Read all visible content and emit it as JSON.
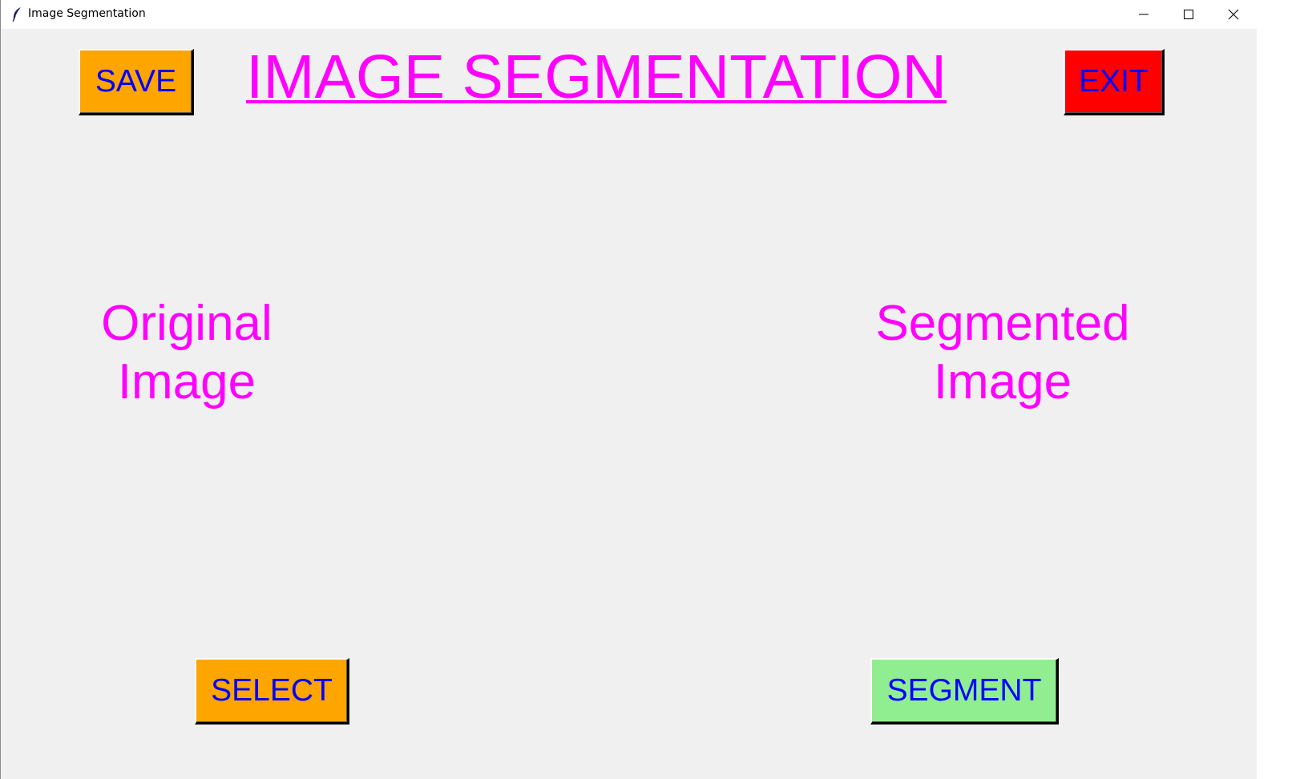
{
  "window": {
    "title": "Image Segmentation",
    "icon": "feather-icon",
    "controls": [
      "minimize-icon",
      "maximize-icon",
      "close-icon"
    ]
  },
  "header": {
    "heading": "IMAGE SEGMENTATION",
    "save_label": "SAVE",
    "exit_label": "EXIT"
  },
  "panels": {
    "original_label": "Original\nImage",
    "segmented_label": "Segmented\nImage"
  },
  "footer": {
    "select_label": "SELECT",
    "segment_label": "SEGMENT"
  },
  "colors": {
    "background": "#f0f0f0",
    "heading_text": "#ff00ff",
    "button_text": "#0000ff",
    "save_button": "#ffa500",
    "exit_button": "#ff0000",
    "select_button": "#ffa500",
    "segment_button": "#90ee90"
  }
}
